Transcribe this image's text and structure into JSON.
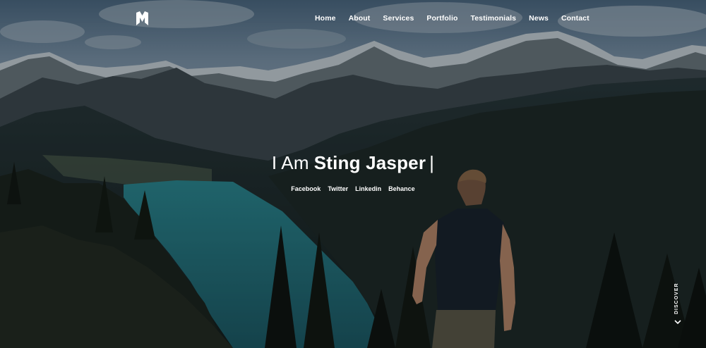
{
  "header": {
    "logo_icon": "m-letter-logo-icon"
  },
  "nav": {
    "items": [
      {
        "label": "Home"
      },
      {
        "label": "About"
      },
      {
        "label": "Services"
      },
      {
        "label": "Portfolio"
      },
      {
        "label": "Testimonials"
      },
      {
        "label": "News"
      },
      {
        "label": "Contact"
      }
    ]
  },
  "hero": {
    "prefix": "I Am",
    "name": "Sting Jasper",
    "cursor": "|",
    "socials": [
      {
        "label": "Facebook"
      },
      {
        "label": "Twitter"
      },
      {
        "label": "Linkedin"
      },
      {
        "label": "Behance"
      }
    ],
    "discover_label": "DISCOVER",
    "discover_icon": "chevron-down-icon"
  },
  "colors": {
    "text": "#ffffff",
    "sky": "#5f7d97",
    "lake": "#2f8a93"
  }
}
